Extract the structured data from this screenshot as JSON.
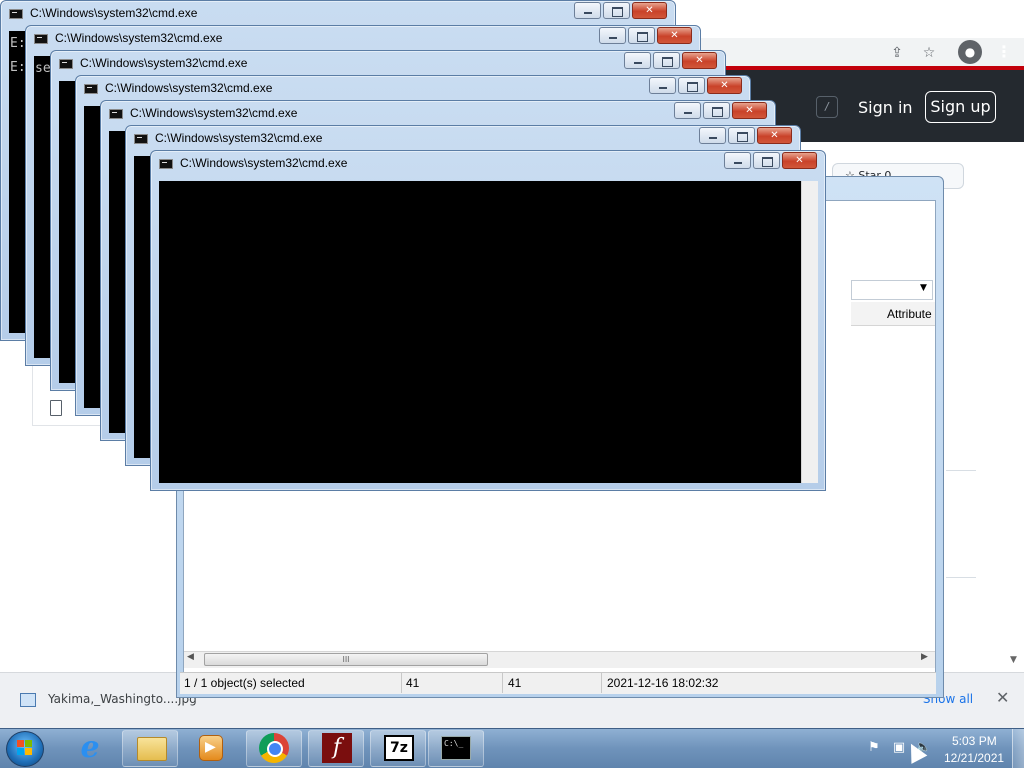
{
  "browser": {
    "gh_slash_key": "/",
    "sign_in": "Sign in",
    "sign_up": "Sign up",
    "star_label": "Star",
    "star_count": "0"
  },
  "download_bar": {
    "file_name": "Yakima,_Washingto....jpg",
    "caret": "^",
    "show_all": "Show all",
    "close": "✕"
  },
  "file_manager": {
    "column_header": "Attribute",
    "status": {
      "selection": "1 / 1 object(s) selected",
      "size": "41",
      "packed": "41",
      "modified": "2021-12-16 18:02:32"
    },
    "thumb_grip": "III"
  },
  "cmd_windows": {
    "title": "C:\\Windows\\system32\\cmd.exe",
    "first_window_lines": "E:\\\nE:\\",
    "second_window_lines": "sel"
  },
  "taskbar": {
    "flash_letter": "f",
    "sevenz_label": "7z",
    "cmd_label": "C:\\_",
    "clock_time": "5:03 PM",
    "clock_date": "12/21/2021"
  },
  "colors": {
    "taskbar": "#6f93bb",
    "github_header": "#24292f",
    "chrome_red": "#c2000b",
    "close_button": "#c9422a"
  }
}
